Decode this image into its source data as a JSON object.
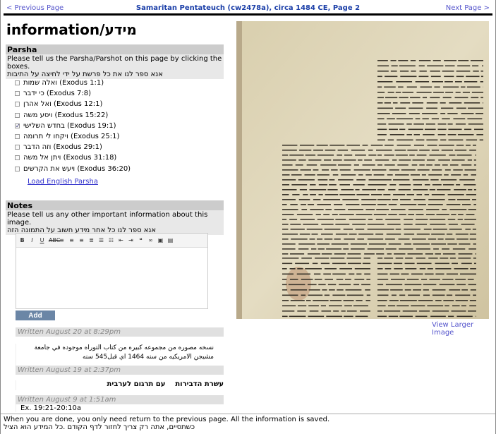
{
  "nav": {
    "prev": "< Previous Page",
    "title": "Samaritan Pentateuch (cw2478a), circa 1484 CE, Page 2",
    "next": "Next Page >"
  },
  "heading": "information/מידע",
  "parsha": {
    "header": "Parsha",
    "desc_en": "Please tell us the Parsha/Parshot on this page by clicking the boxes.",
    "desc_he": "אנא ספר לנו את כל פרשת על ידי לחיצה על התיבות",
    "items": [
      {
        "label": "ואלה שמות (Exodus 1:1)",
        "checked": false
      },
      {
        "label": "כי ידבר (Exodus 7:8)",
        "checked": false
      },
      {
        "label": "ואל אהרן (Exodus 12:1)",
        "checked": false
      },
      {
        "label": "ויסע משה (Exodus 15:22)",
        "checked": false
      },
      {
        "label": "בחדש השלישי (Exodus 19:1)",
        "checked": true
      },
      {
        "label": "ויקחו לי תרומה (Exodus 25:1)",
        "checked": false
      },
      {
        "label": "וזה הדבר (Exodus 29:1)",
        "checked": false
      },
      {
        "label": "ויתן אל משה (Exodus 31:18)",
        "checked": false
      },
      {
        "label": "ויעש את הקרשים (Exodus 36:20)",
        "checked": false
      }
    ],
    "load_link": "Load English Parsha"
  },
  "notes": {
    "header": "Notes",
    "desc_en": "Please tell us any other important information about this image.",
    "desc_he": "אנא ספר לנו כל אחר מידע חשוב על התמונה הזה",
    "toolbar": [
      "B",
      "I",
      "U",
      "ABC",
      "align-left",
      "align-center",
      "align-right",
      "justify",
      "bullet-list",
      "numbered-list",
      "outdent",
      "indent",
      "blockquote",
      "link",
      "image",
      "media"
    ],
    "add_button": "Add Note",
    "entries": [
      {
        "written": "Written August 20 at 8:29pm",
        "text": "نسخه مصوره من مجموعه كبيره من كتاب التوراه موجوده في جامعة مشيجن الامريكيه من سنه 1464 اي قبل545 سنه"
      },
      {
        "written": "Written August 19 at 2:37pm",
        "text": "עשרת הדבירות    עם תרגום לערבית"
      },
      {
        "written": "Written August 9 at 1:51am",
        "text": "Ex. 19:21-20:10a"
      }
    ]
  },
  "image": {
    "view_larger": "View Larger Image"
  },
  "footer": {
    "en": "When you are done, you only need return to the previous page. All the information is saved.",
    "he": "כשתסיים, אתה רק צריך לחזור לדף הקודם .כל המידע הוא הציל"
  }
}
